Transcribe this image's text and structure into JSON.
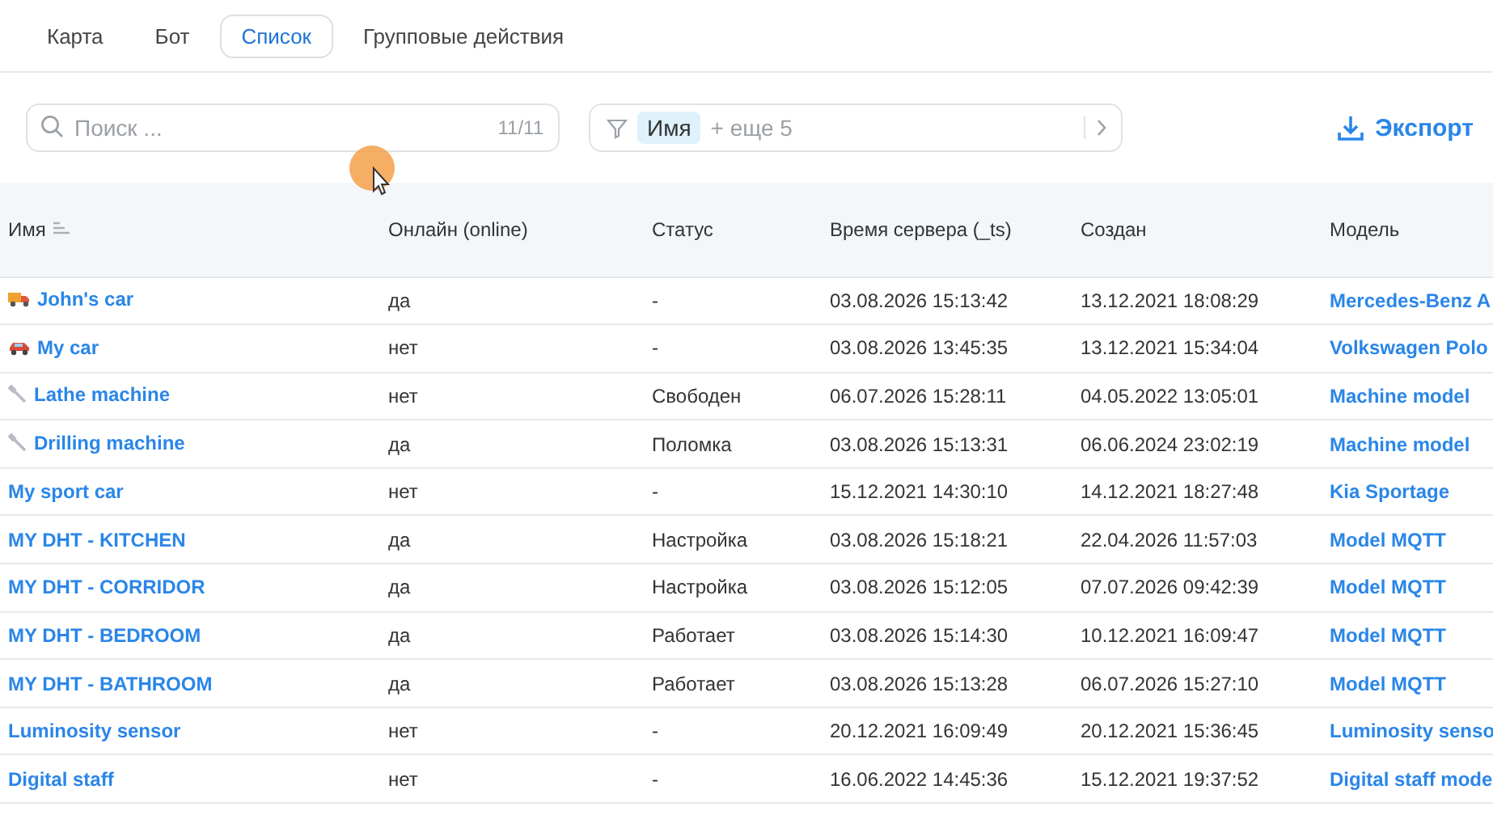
{
  "tabs": [
    {
      "label": "Карта",
      "selected": false
    },
    {
      "label": "Бот",
      "selected": false
    },
    {
      "label": "Список",
      "selected": true
    },
    {
      "label": "Групповые действия",
      "selected": false
    }
  ],
  "search": {
    "placeholder": "Поиск ...",
    "count": "11/11"
  },
  "filter": {
    "chip": "Имя",
    "more": "+ еще 5"
  },
  "export": "Экспорт",
  "table": {
    "columns": [
      "Имя",
      "Онлайн (online)",
      "Статус",
      "Время сервера (_ts)",
      "Создан",
      "Модель"
    ],
    "rows": [
      {
        "kind": "truck",
        "name": "John's car",
        "online": "да",
        "status": "-",
        "server_time": "03.08.2026 15:13:42",
        "created": "13.12.2021 18:08:29",
        "model": "Mercedes-Benz A"
      },
      {
        "kind": "car",
        "name": "My car",
        "online": "нет",
        "status": "-",
        "server_time": "03.08.2026 13:45:35",
        "created": "13.12.2021 15:34:04",
        "model": "Volkswagen Polo"
      },
      {
        "kind": "tool",
        "name": "Lathe machine",
        "online": "нет",
        "status": "Свободен",
        "server_time": "06.07.2026 15:28:11",
        "created": "04.05.2022 13:05:01",
        "model": "Machine model"
      },
      {
        "kind": "tool",
        "name": "Drilling machine",
        "online": "да",
        "status": "Поломка",
        "server_time": "03.08.2026 15:13:31",
        "created": "06.06.2024 23:02:19",
        "model": "Machine model"
      },
      {
        "kind": "plain",
        "name": "My sport car",
        "online": "нет",
        "status": "-",
        "server_time": "15.12.2021 14:30:10",
        "created": "14.12.2021 18:27:48",
        "model": "Kia Sportage"
      },
      {
        "kind": "plain",
        "name": "MY DHT - KITCHEN",
        "online": "да",
        "status": "Настройка",
        "server_time": "03.08.2026 15:18:21",
        "created": "22.04.2026 11:57:03",
        "model": "Model MQTT"
      },
      {
        "kind": "plain",
        "name": "MY DHT - CORRIDOR",
        "online": "да",
        "status": "Настройка",
        "server_time": "03.08.2026 15:12:05",
        "created": "07.07.2026 09:42:39",
        "model": "Model MQTT"
      },
      {
        "kind": "plain",
        "name": "MY DHT - BEDROOM",
        "online": "да",
        "status": "Работает",
        "server_time": "03.08.2026 15:14:30",
        "created": "10.12.2021 16:09:47",
        "model": "Model MQTT"
      },
      {
        "kind": "plain",
        "name": "MY DHT - BATHROOM",
        "online": "да",
        "status": "Работает",
        "server_time": "03.08.2026 15:13:28",
        "created": "06.07.2026 15:27:10",
        "model": "Model MQTT"
      },
      {
        "kind": "plain",
        "name": "Luminosity sensor",
        "online": "нет",
        "status": "-",
        "server_time": "20.12.2021 16:09:49",
        "created": "20.12.2021 15:36:45",
        "model": "Luminosity senso"
      },
      {
        "kind": "plain",
        "name": "Digital staff",
        "online": "нет",
        "status": "-",
        "server_time": "16.06.2022 14:45:36",
        "created": "15.12.2021 19:37:52",
        "model": "Digital staff mode"
      }
    ]
  }
}
